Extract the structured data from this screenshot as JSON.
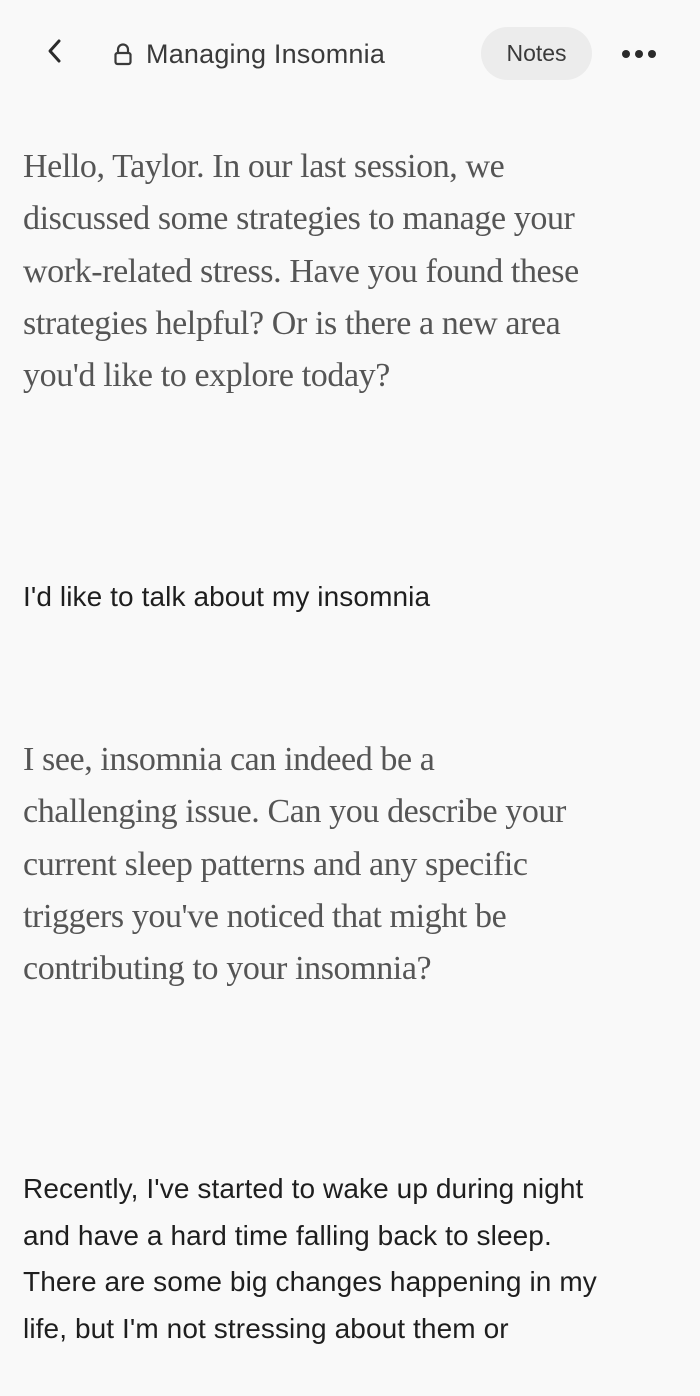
{
  "header": {
    "title": "Managing Insomnia",
    "notes_label": "Notes",
    "back_icon": "chevron-left-icon",
    "lock_icon": "lock-icon",
    "more_icon": "more-horizontal-icon"
  },
  "messages": [
    {
      "role": "assistant",
      "text": "Hello, Taylor. In our last session, we discussed some strategies to manage your work-related stress. Have you found these strategies helpful? Or is there a new area you'd like to explore today?"
    },
    {
      "role": "user",
      "text": "I'd like to talk about my insomnia"
    },
    {
      "role": "assistant",
      "text": "I see, insomnia can indeed be a challenging issue. Can you describe your current sleep patterns and any specific triggers you've noticed that might be contributing to your insomnia?"
    },
    {
      "role": "user",
      "text": "Recently, I've started to wake up during night and have a hard time falling back to sleep. There are some big changes happening in my life, but I'm not stressing about them or"
    }
  ],
  "colors": {
    "background": "#f9f9f9",
    "notes_button_bg": "#ececec",
    "assistant_text": "#555555",
    "user_text": "#1e1e1e"
  }
}
